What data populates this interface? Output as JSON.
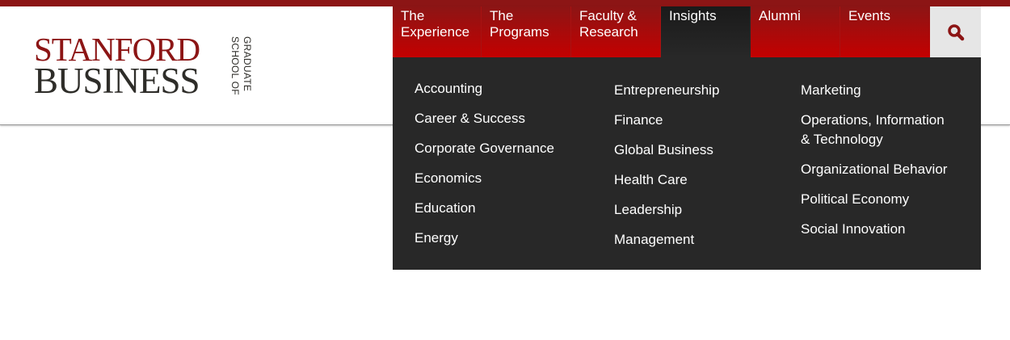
{
  "logo": {
    "line1": "STANFORD",
    "line2": "BUSINESS",
    "vertical1": "GRADUATE",
    "vertical2": "SCHOOL OF"
  },
  "nav": {
    "items": [
      {
        "line1": "The",
        "line2": "Experience"
      },
      {
        "line1": "The",
        "line2": "Programs"
      },
      {
        "line1": "Faculty &",
        "line2": "Research"
      },
      {
        "line1": "Insights",
        "line2": ""
      },
      {
        "line1": "Alumni",
        "line2": ""
      },
      {
        "line1": "Events",
        "line2": ""
      }
    ],
    "active": "Insights",
    "search_icon": "search-icon"
  },
  "insights_menu": {
    "col1": [
      "Accounting",
      "Career & Success",
      "Corporate Governance",
      "Economics",
      "Education",
      "Energy"
    ],
    "col2": [
      "Entrepreneurship",
      "Finance",
      "Global Business",
      "Health Care",
      "Leadership",
      "Management"
    ],
    "col3": [
      "Marketing",
      "Operations, Information",
      "& Technology",
      "Organizational Behavior",
      "Political Economy",
      "Social Innovation"
    ]
  },
  "colors": {
    "brand_red": "#8c1515",
    "nav_red": "#c40000",
    "dropdown_bg": "#282828"
  }
}
